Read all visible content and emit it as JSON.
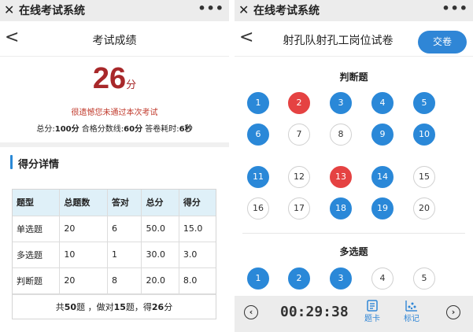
{
  "app": {
    "close_glyph": "✕",
    "title": "在线考试系统",
    "more_glyph": "•••"
  },
  "left": {
    "back_glyph": "<",
    "page_title": "考试成绩",
    "score": "26",
    "score_unit": "分",
    "fail_message": "很遗憾您未通过本次考试",
    "summary": {
      "total_label": "总分:",
      "total_value": "100分",
      "pass_label": "合格分数线:",
      "pass_value": "60分",
      "time_label": "答卷耗时:",
      "time_value": "6秒"
    },
    "section_title": "得分详情",
    "table": {
      "headers": [
        "题型",
        "总题数",
        "答对",
        "总分",
        "得分"
      ],
      "rows": [
        [
          "单选题",
          "20",
          "6",
          "50.0",
          "15.0"
        ],
        [
          "多选题",
          "10",
          "1",
          "30.0",
          "3.0"
        ],
        [
          "判断题",
          "20",
          "8",
          "20.0",
          "8.0"
        ]
      ],
      "footer": {
        "pre": "共",
        "total": "50",
        "mid1": "题 ，做对",
        "correct": "15",
        "mid2": "题，得",
        "score": "26",
        "unit": "分"
      }
    }
  },
  "right": {
    "back_glyph": "<",
    "page_title": "射孔队射孔工岗位试卷",
    "submit_label": "交卷",
    "sections": [
      {
        "title": "判断题",
        "questions": [
          {
            "n": "1",
            "state": "correct"
          },
          {
            "n": "2",
            "state": "wrong"
          },
          {
            "n": "3",
            "state": "correct"
          },
          {
            "n": "4",
            "state": "correct"
          },
          {
            "n": "5",
            "state": "correct"
          },
          {
            "n": "6",
            "state": "correct"
          },
          {
            "n": "7",
            "state": "blank"
          },
          {
            "n": "8",
            "state": "blank"
          },
          {
            "n": "9",
            "state": "correct"
          },
          {
            "n": "10",
            "state": "correct"
          },
          {
            "n": "11",
            "state": "correct"
          },
          {
            "n": "12",
            "state": "blank"
          },
          {
            "n": "13",
            "state": "wrong"
          },
          {
            "n": "14",
            "state": "correct"
          },
          {
            "n": "15",
            "state": "blank"
          },
          {
            "n": "16",
            "state": "blank"
          },
          {
            "n": "17",
            "state": "blank"
          },
          {
            "n": "18",
            "state": "correct"
          },
          {
            "n": "19",
            "state": "correct"
          },
          {
            "n": "20",
            "state": "blank"
          }
        ]
      },
      {
        "title": "多选题",
        "questions": [
          {
            "n": "1",
            "state": "correct"
          },
          {
            "n": "2",
            "state": "correct"
          },
          {
            "n": "3",
            "state": "correct"
          },
          {
            "n": "4",
            "state": "blank"
          },
          {
            "n": "5",
            "state": "blank"
          }
        ]
      }
    ],
    "bottom": {
      "prev_glyph": "‹",
      "next_glyph": "›",
      "timer": "00:29:38",
      "card_icon": "answer-card-icon",
      "card_label": "题卡",
      "mark_icon": "mark-icon",
      "mark_label": "标记"
    }
  },
  "colors": {
    "correct": "#2a88d8",
    "wrong": "#e54242",
    "score": "#a8282a",
    "accent": "#2f86d6"
  }
}
